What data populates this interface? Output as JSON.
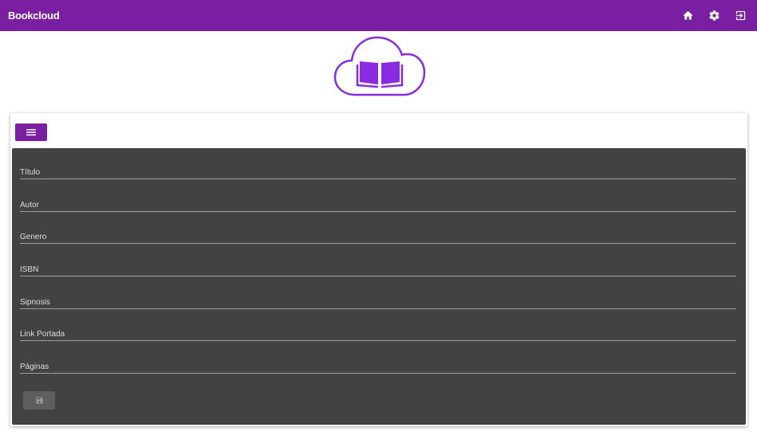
{
  "app": {
    "brand": "Bookcloud"
  },
  "topbar": {
    "icons": [
      "home-icon",
      "gear-icon",
      "logout-icon"
    ]
  },
  "colors": {
    "primary": "#7b1fa2",
    "panel": "#424242",
    "logo": "#8a2be2"
  },
  "form": {
    "fields": [
      {
        "label": "Título"
      },
      {
        "label": "Autor"
      },
      {
        "label": "Genero"
      },
      {
        "label": "ISBN"
      },
      {
        "label": "Sipnosis"
      },
      {
        "label": "Link Portada"
      },
      {
        "label": "Páginas"
      }
    ],
    "save_icon": "save-icon",
    "menu_icon": "menu-list-icon"
  }
}
